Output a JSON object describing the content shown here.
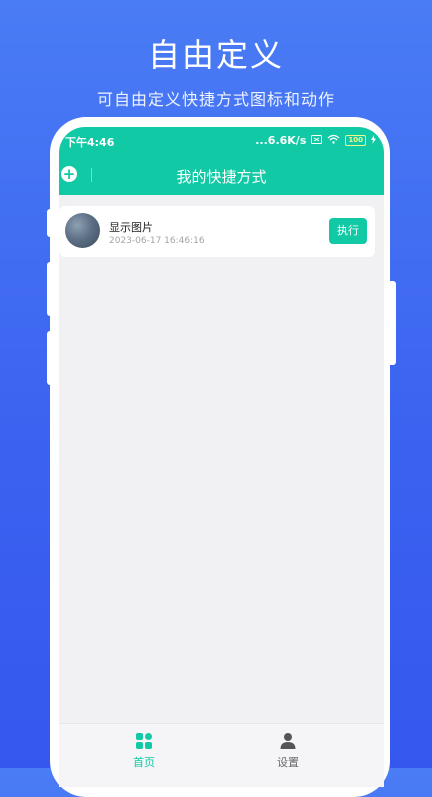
{
  "promo": {
    "title": "自由定义",
    "subtitle": "可自由定义快捷方式图标和动作"
  },
  "status_bar": {
    "time": "下午4:46",
    "network_speed": "...6.6K/s",
    "battery": "100"
  },
  "header": {
    "title": "我的快捷方式",
    "add_icon": "plus-circle-icon"
  },
  "shortcuts": [
    {
      "name": "显示图片",
      "date": "2023-06-17 16:46:16",
      "action_label": "执行"
    }
  ],
  "tabbar": {
    "tabs": [
      {
        "label": "首页",
        "icon": "grid-icon",
        "active": true
      },
      {
        "label": "设置",
        "icon": "person-icon",
        "active": false
      }
    ]
  },
  "colors": {
    "accent": "#12c9a5",
    "background_blue": "#3d68f1"
  }
}
